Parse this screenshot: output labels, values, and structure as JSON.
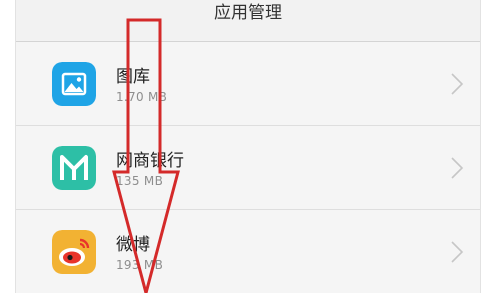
{
  "header": {
    "title": "应用管理"
  },
  "apps": [
    {
      "name": "图库",
      "size": "1.70 MB",
      "icon": "gallery-icon"
    },
    {
      "name": "网商银行",
      "size": "135 MB",
      "icon": "mybank-icon"
    },
    {
      "name": "微博",
      "size": "193 MB",
      "icon": "weibo-icon"
    }
  ],
  "colors": {
    "annotation": "#d42a2a",
    "gallery": "#1fa4e6",
    "mybank": "#2dbfa6",
    "weibo": "#f2b233"
  }
}
